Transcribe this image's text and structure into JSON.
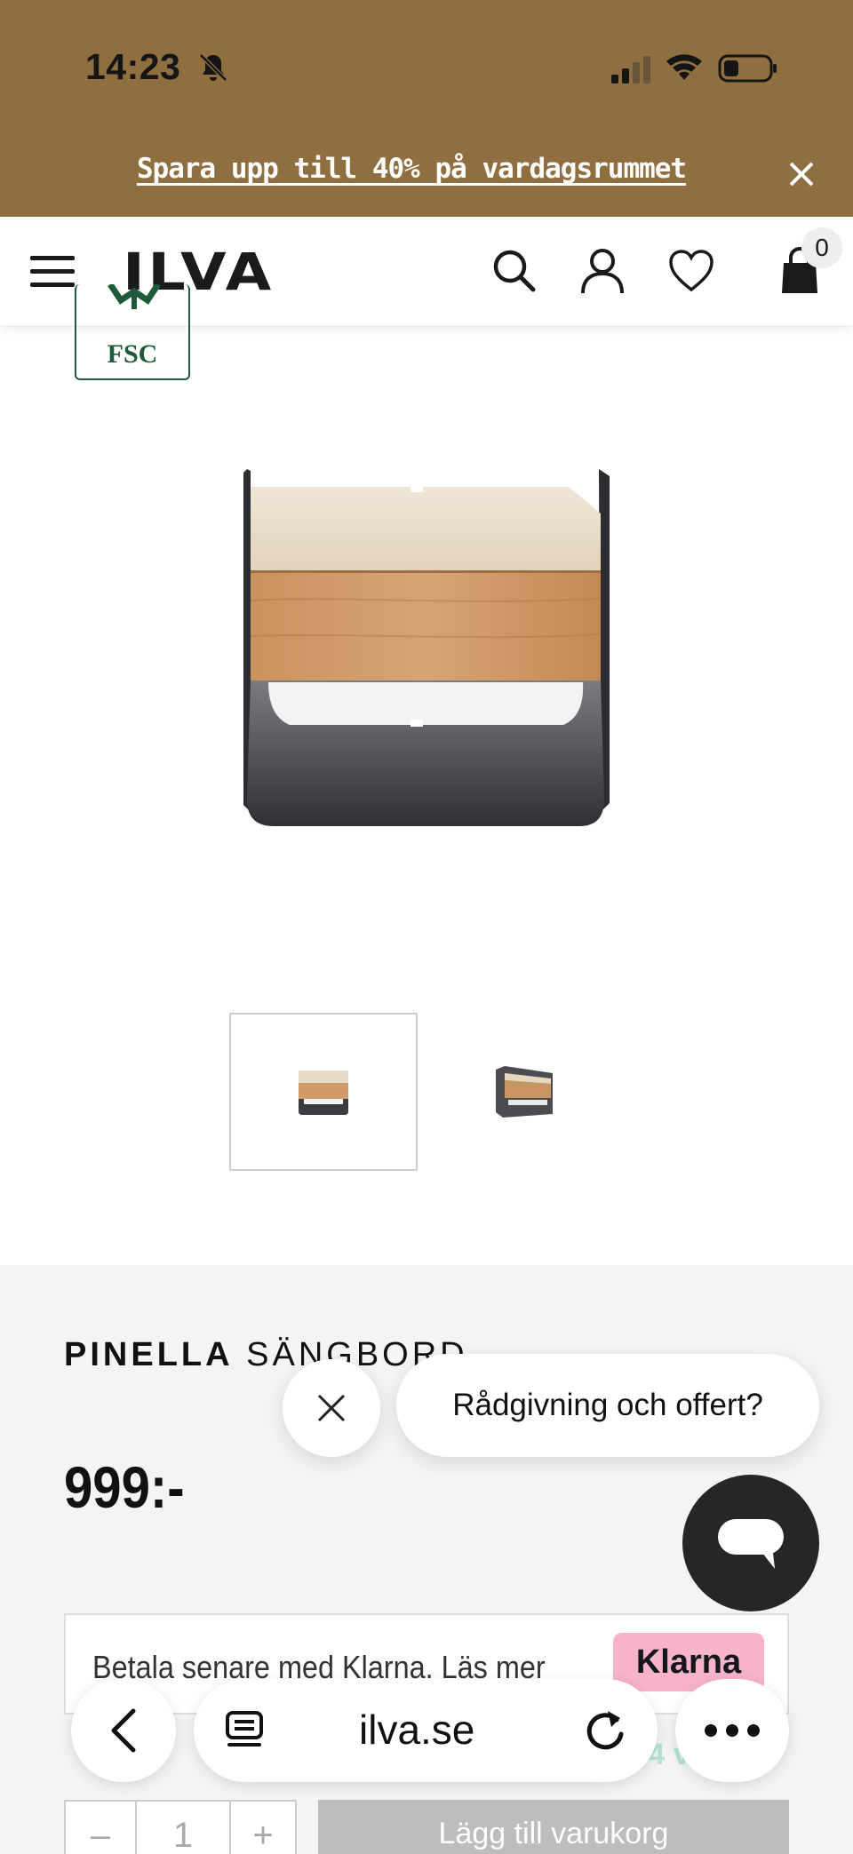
{
  "status_bar": {
    "time": "14:23",
    "icons": [
      "bell-muted-icon",
      "signal-icon",
      "wifi-icon",
      "battery-icon"
    ]
  },
  "promo": {
    "text": "Spara upp till 40% på vardagsrummet",
    "close_icon": "close-icon",
    "background": "#8f6e3f"
  },
  "header": {
    "logo": "ILVA",
    "icons": [
      "menu-icon",
      "search-icon",
      "account-icon",
      "heart-icon",
      "cart-icon"
    ],
    "cart_count": "0"
  },
  "gallery": {
    "badge": "FSC",
    "thumbnail_count": 2,
    "active_thumbnail": 1
  },
  "product": {
    "brand": "PINELLA",
    "name": "SÄNGBORD",
    "price": "999:-",
    "klarna_text": "Betala senare med Klarna. Läs mer",
    "klarna_badge": "Klarna",
    "delivery_text": "Leveranstid: ... 4 v...",
    "quantity": "1",
    "minus": "–",
    "plus": "+",
    "add_to_cart": "Lägg till varukorg"
  },
  "chat": {
    "bubble_text": "Rådgivning och offert?",
    "close_icon": "close-icon",
    "fab_icon": "chat-icon"
  },
  "browser": {
    "url": "ilva.se",
    "icons": [
      "back-icon",
      "tabs-icon",
      "reload-icon",
      "more-icon"
    ]
  }
}
